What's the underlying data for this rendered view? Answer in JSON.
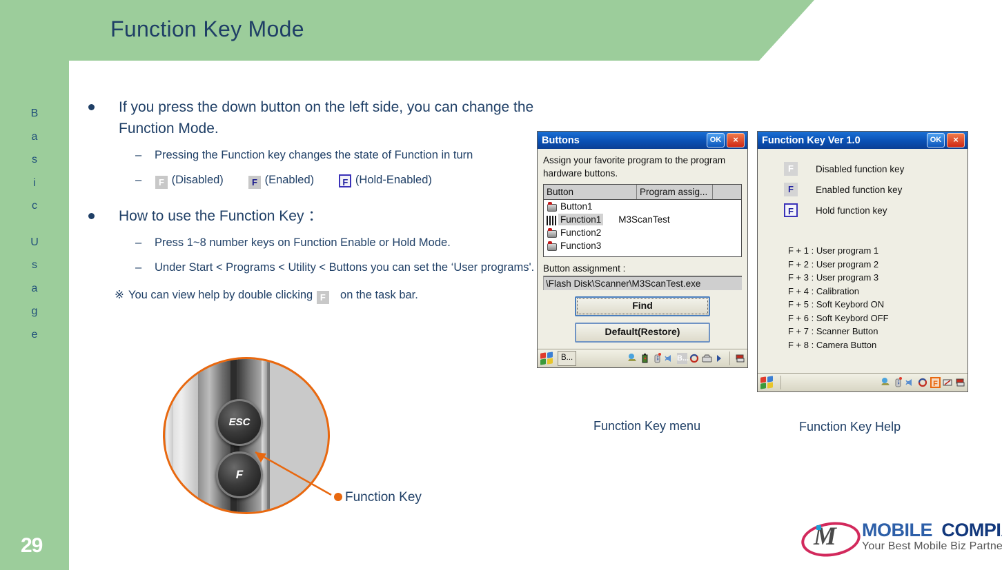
{
  "slide": {
    "title": "Function Key Mode",
    "page_number": "29",
    "side_label_words": [
      "Basic",
      "Usage"
    ]
  },
  "content": {
    "bullet1": "If you press the down button on the left side, you can change the Function Mode.",
    "sub1a": "Pressing the Function key changes the state of Function in turn",
    "states": {
      "disabled_icon": "F",
      "disabled_label": "(Disabled)",
      "enabled_icon": "F",
      "enabled_label": "(Enabled)",
      "hold_icon": "F",
      "hold_label": "(Hold-Enabled)"
    },
    "bullet2": "How to use the Function Key ：",
    "sub2a": "Press 1~8 number keys on Function Enable or Hold Mode.",
    "sub2b": "Under Start < Programs < Utility < Buttons you can set the ‘User programs'.",
    "note_mark": "※",
    "note_pre": "You can view help by double clicking",
    "note_icon": "F",
    "note_post": "on the task bar."
  },
  "photo": {
    "esc_key_label": "ESC",
    "function_key_label": "F",
    "callout_label": "Function Key"
  },
  "buttons_dialog": {
    "title": "Buttons",
    "ok_label": "OK",
    "close_label": "×",
    "description": "Assign your favorite program to the program hardware buttons.",
    "table": {
      "headers": [
        "Button",
        "Program assig...",
        ""
      ],
      "rows": [
        {
          "icon": "button-icon",
          "name": "Button1",
          "program": "",
          "selected": false
        },
        {
          "icon": "barcode-icon",
          "name": "Function1",
          "program": "M3ScanTest",
          "selected": true
        },
        {
          "icon": "button-icon",
          "name": "Function2",
          "program": "",
          "selected": false
        },
        {
          "icon": "button-icon",
          "name": "Function3",
          "program": "",
          "selected": false
        }
      ]
    },
    "assignment_label": "Button assignment :",
    "assignment_value": "\\Flash Disk\\Scanner\\M3ScanTest.exe",
    "find_button": "Find",
    "default_button": "Default(Restore)",
    "taskbar_task": "B...",
    "caption": "Function Key menu"
  },
  "help_dialog": {
    "title": "Function Key Ver 1.0",
    "ok_label": "OK",
    "close_label": "×",
    "legend": [
      {
        "icon": "F",
        "state": "disabled",
        "label": "Disabled function key"
      },
      {
        "icon": "F",
        "state": "enabled",
        "label": "Enabled function key"
      },
      {
        "icon": "F",
        "state": "hold",
        "label": "Hold function key"
      }
    ],
    "shortcuts": [
      "F + 1 : User program 1",
      "F + 2 : User program 2",
      "F + 3 : User program 3",
      "F + 4 : Calibration",
      "F + 5 : Soft Keybord ON",
      "F + 6 : Soft Keybord OFF",
      "F + 7 : Scanner Button",
      "F + 8 : Camera Button"
    ],
    "tray_f_label": "F",
    "caption": "Function Key Help"
  },
  "logo": {
    "word1": "MOBILE",
    "word2": "COMPIA",
    "tagline": "Your Best Mobile Biz Partner",
    "mark_letter": "M"
  },
  "colors": {
    "green": "#9ccd9b",
    "navy": "#1f3f66",
    "orange": "#e8680f",
    "dialog_blue": "#0a50b4"
  }
}
